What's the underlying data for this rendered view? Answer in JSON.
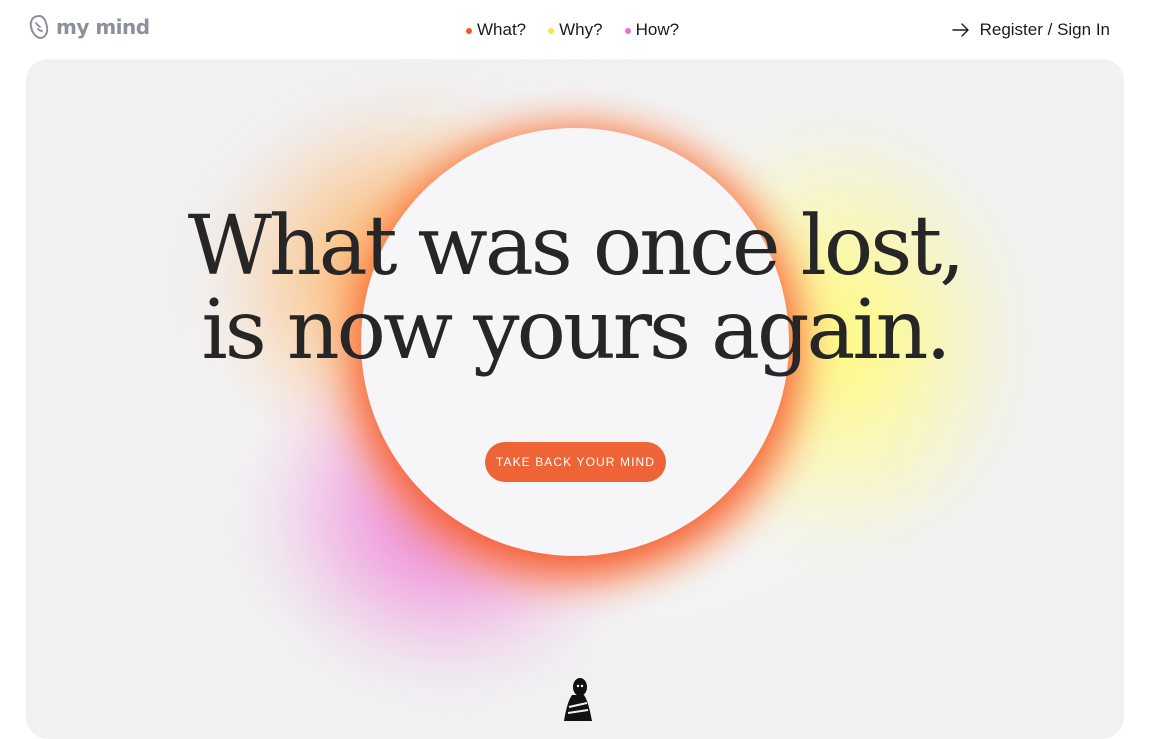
{
  "brand": {
    "logo_text": "my mind",
    "logo_icon": "brain-outline-icon",
    "logo_color": "#8b909a"
  },
  "nav": {
    "items": [
      {
        "label": "What?",
        "dot_color": "#f05a28"
      },
      {
        "label": "Why?",
        "dot_color": "#f4e83a"
      },
      {
        "label": "How?",
        "dot_color": "#ec6fc9"
      }
    ]
  },
  "auth": {
    "label": "Register / Sign In",
    "icon": "arrow-right-icon"
  },
  "hero": {
    "headline_line1": "What was once lost,",
    "headline_line2": "is now yours again.",
    "cta_label": "TAKE BACK YOUR MIND",
    "cta_color": "#ef6436",
    "background_color": "#f1f1f3",
    "illustration": "meditating-figure-icon"
  }
}
